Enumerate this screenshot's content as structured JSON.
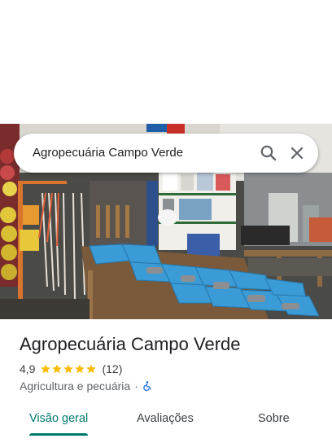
{
  "search": {
    "query": "Agropecuária Campo Verde"
  },
  "icons": {
    "search": "search-icon",
    "close": "close-icon",
    "star": "star-icon",
    "accessible": "wheelchair-icon"
  },
  "place": {
    "name": "Agropecuária Campo Verde",
    "rating": "4,9",
    "stars": 5,
    "reviews_count": "(12)",
    "category": "Agricultura e pecuária",
    "separator": "·"
  },
  "tabs": [
    {
      "label": "Visão geral",
      "active": true
    },
    {
      "label": "Avaliações",
      "active": false
    },
    {
      "label": "Sobre",
      "active": false
    }
  ],
  "colors": {
    "accent": "#00796b",
    "star": "#fbbc04",
    "accessible_icon": "#1a73e8"
  }
}
